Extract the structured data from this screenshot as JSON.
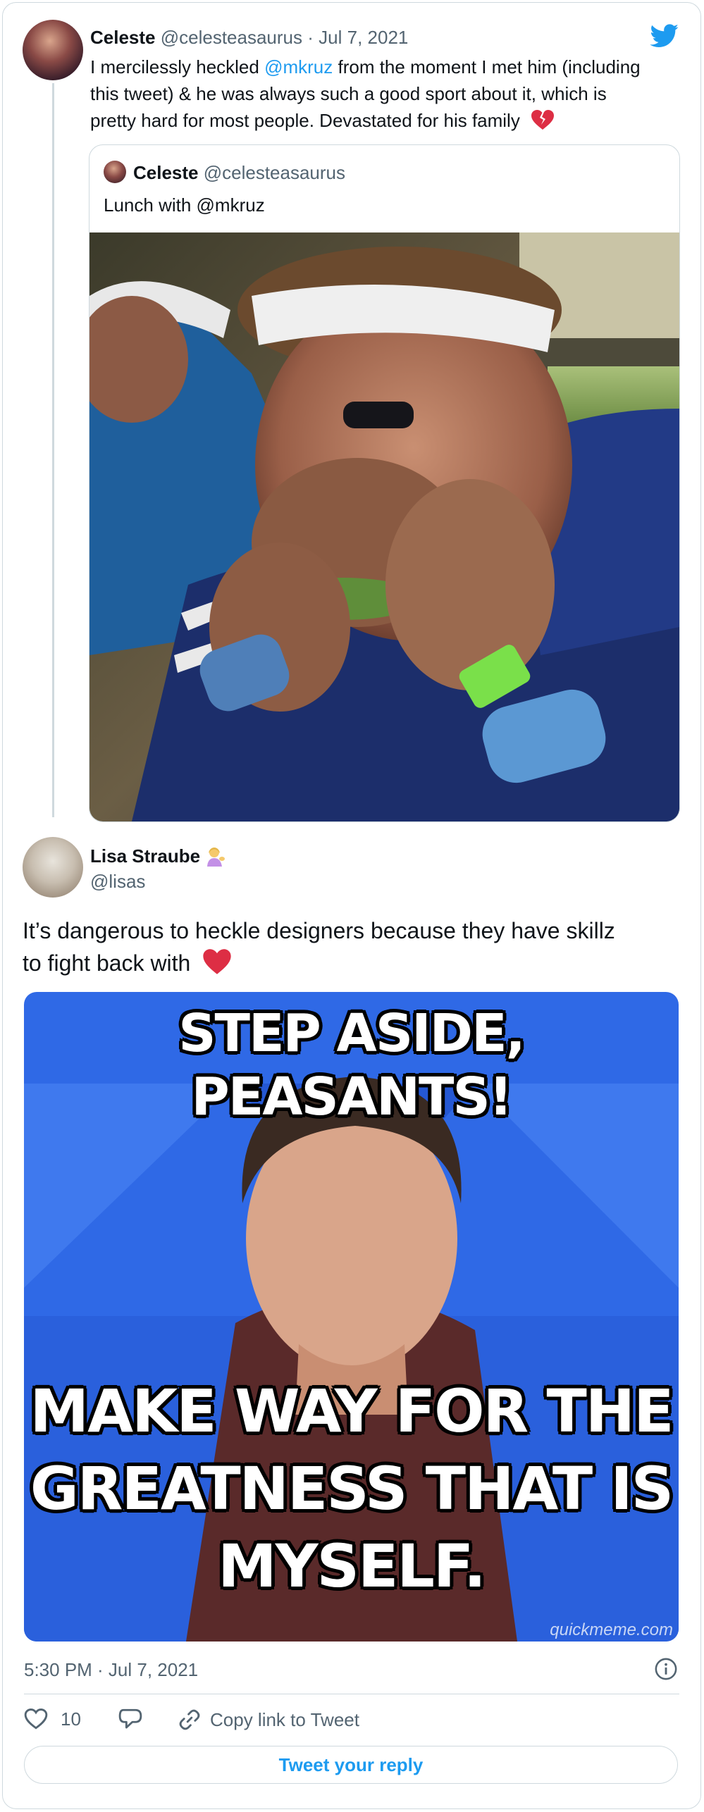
{
  "tweet1": {
    "name": "Celeste",
    "handle": "@celesteasaurus",
    "separator": "·",
    "date": "Jul 7, 2021",
    "text_a": "I mercilessly heckled ",
    "mention": "@mkruz",
    "text_b": " from the moment I met him (including",
    "line2": "this tweet) & he was always such a good sport about it, which is",
    "line3": "pretty hard for most people. Devastated for his family",
    "emoji": "broken-heart-icon"
  },
  "quoted": {
    "name": "Celeste",
    "handle": "@celesteasaurus",
    "text": "Lunch with @mkruz"
  },
  "main": {
    "name": "Lisa Straube",
    "handle": "@lisas",
    "name_emoji": "person-tipping-hand-icon",
    "text_line1": "It’s dangerous to heckle designers because they have skillz",
    "text_line2": "to fight back with",
    "text_emoji": "red-heart-icon",
    "meme_top": "STEP ASIDE, PEASANTS!",
    "meme_bottom_1": "MAKE WAY FOR THE",
    "meme_bottom_2": "GREATNESS THAT IS",
    "meme_bottom_3": "MYSELF.",
    "meme_watermark": "quickmeme.com",
    "time": "5:30 PM · Jul 7, 2021"
  },
  "actions": {
    "like_count": "10",
    "copy_link": "Copy link to Tweet",
    "reply_button": "Tweet your reply"
  },
  "colors": {
    "accent": "#1d9bf0",
    "like": "#536471",
    "heart": "#e0245e"
  }
}
